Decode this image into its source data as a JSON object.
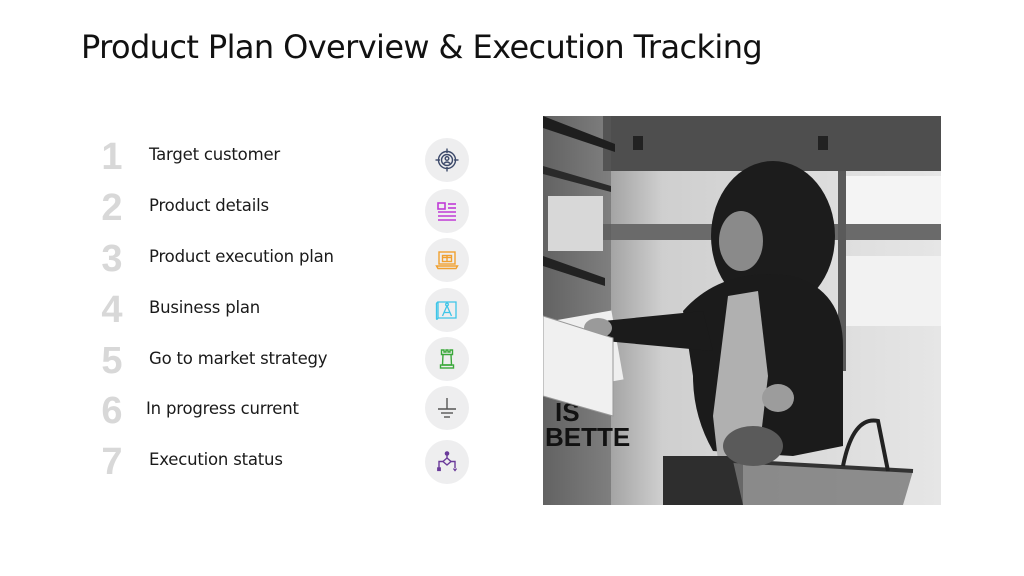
{
  "title": "Product Plan Overview & Execution Tracking",
  "items": [
    {
      "number": "1",
      "label": "Target customer",
      "icon": "target-customer-icon",
      "color": "#3d4a6b"
    },
    {
      "number": "2",
      "label": "Product details",
      "icon": "document-list-icon",
      "color": "#c03ad6"
    },
    {
      "number": "3",
      "label": "Product execution plan",
      "icon": "laptop-box-icon",
      "color": "#f0a030"
    },
    {
      "number": "4",
      "label": "Business plan",
      "icon": "blueprint-compass-icon",
      "color": "#3ec5e8"
    },
    {
      "number": "5",
      "label": "Go to market strategy",
      "icon": "chess-rook-icon",
      "color": "#3aa83a"
    },
    {
      "number": "6",
      "label": "In progress current",
      "icon": "ground-icon",
      "color": "#555555"
    },
    {
      "number": "7",
      "label": "Execution status",
      "icon": "flowchart-icon",
      "color": "#6a3a9a"
    }
  ],
  "photo": {
    "description": "Black and white photo of a woman with curly hair shopping in a grocery store holding a basket",
    "sign_text": "IS BETTER"
  }
}
